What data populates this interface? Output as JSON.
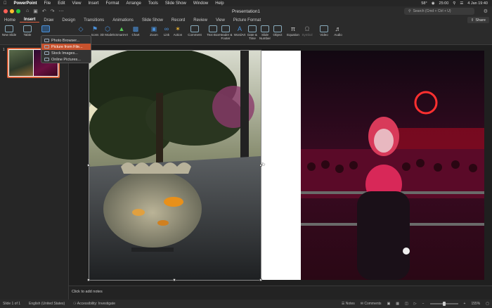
{
  "menubar": {
    "app": "PowerPoint",
    "items": [
      "File",
      "Edit",
      "View",
      "Insert",
      "Format",
      "Arrange",
      "Tools",
      "Slide Show",
      "Window",
      "Help"
    ],
    "battery": "58°",
    "time": "25:00",
    "date": "4 Jan  19:40"
  },
  "titlebar": {
    "title": "Presentation1",
    "search_placeholder": "Search (Cmd + Ctrl + U)"
  },
  "tabs": [
    "Home",
    "Insert",
    "Draw",
    "Design",
    "Transitions",
    "Animations",
    "Slide Show",
    "Record",
    "Review",
    "View",
    "Picture Format"
  ],
  "active_tab": "Insert",
  "share_label": "Share",
  "ribbon": {
    "new_slide": "New Slide",
    "table": "Table",
    "icons": "Icons",
    "models": "3D Models",
    "smartart": "SmartArt",
    "chart": "Chart",
    "zoom": "Zoom",
    "link": "Link",
    "action": "Action",
    "comment": "Comment",
    "text_box": "Text Box",
    "header_footer": "Header & Footer",
    "wordart": "WordArt",
    "date_time": "Date & Time",
    "slide_number": "Slide Number",
    "object": "Object",
    "equation": "Equation",
    "symbol": "Symbol",
    "video": "Video",
    "audio": "Audio"
  },
  "picture_menu": {
    "items": [
      {
        "label": "Photo Browser...",
        "selected": false
      },
      {
        "label": "Picture from File...",
        "selected": true
      },
      {
        "label": "Stock Images...",
        "selected": false
      },
      {
        "label": "Online Pictures...",
        "selected": false
      }
    ]
  },
  "slide_panel": {
    "slide_number": "1"
  },
  "notes_placeholder": "Click to add notes",
  "status": {
    "slide_of": "Slide 1 of 1",
    "language": "English (United States)",
    "accessibility": "Accessibility: Investigate",
    "notes": "Notes",
    "comments": "Comments",
    "zoom": "155%"
  },
  "colors": {
    "accent": "#c7522d",
    "thumb_border": "#d9623a"
  }
}
